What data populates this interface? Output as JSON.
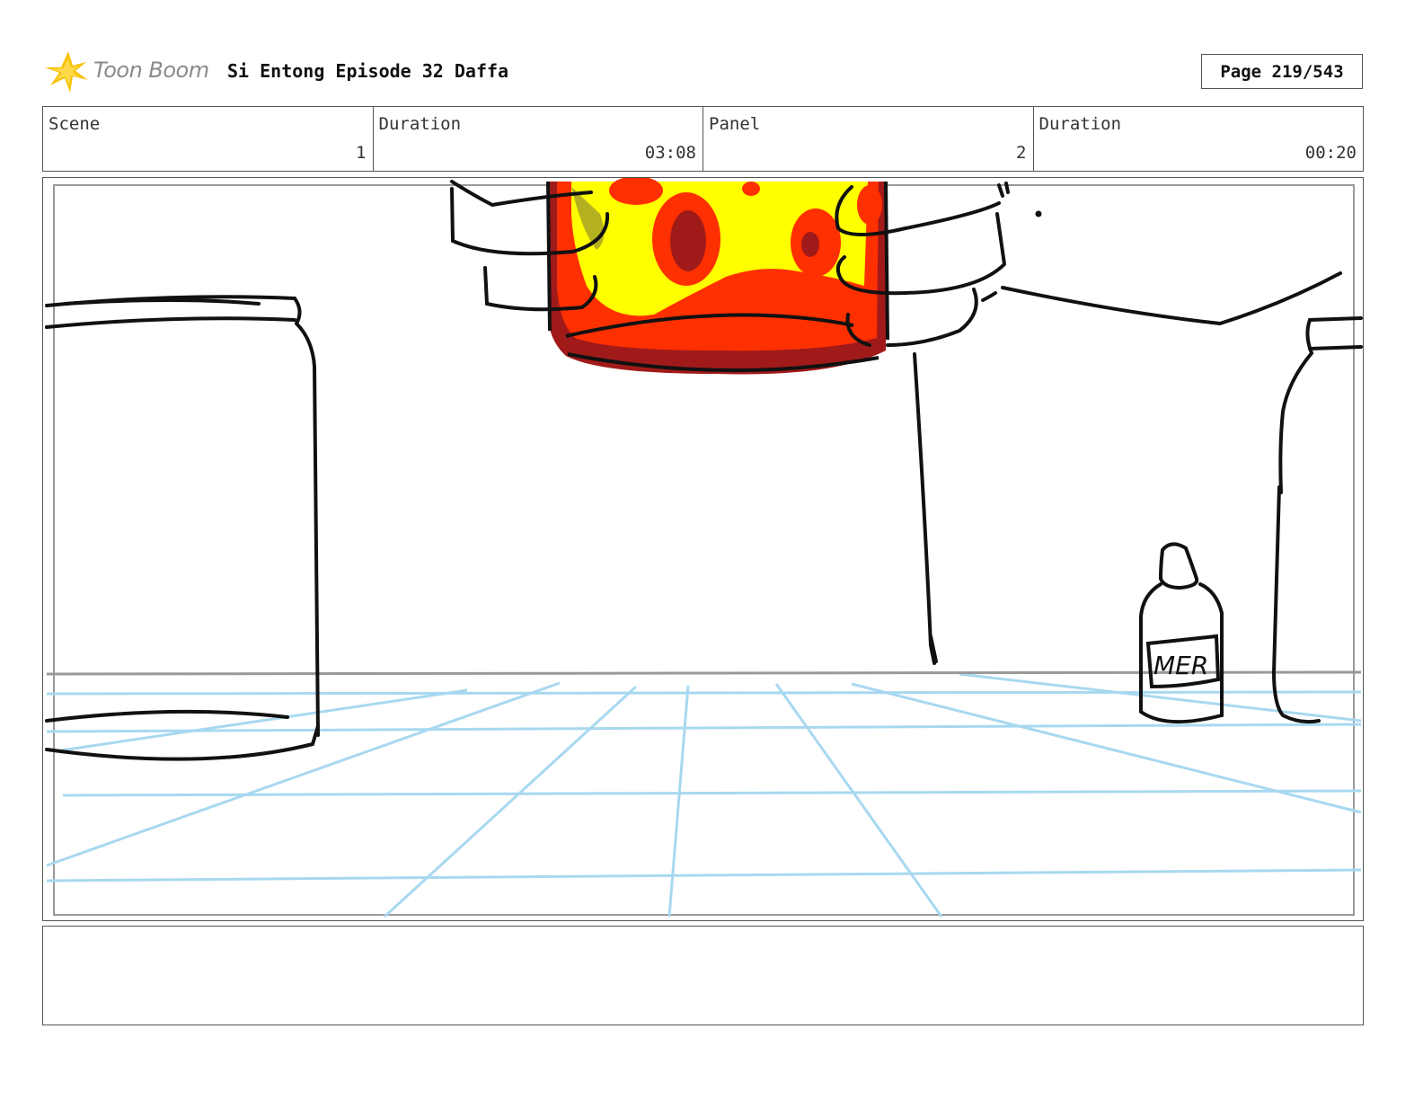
{
  "header": {
    "logo_text": "Toon Boom",
    "project_title": "Si Entong Episode 32 Daffa",
    "page_label": "Page 219/543"
  },
  "info": [
    {
      "label": "Scene",
      "value": "1"
    },
    {
      "label": "Duration",
      "value": "03:08"
    },
    {
      "label": "Panel",
      "value": "2"
    },
    {
      "label": "Duration",
      "value": "00:20"
    }
  ],
  "panel": {
    "bottle_label": "MER",
    "floor_grid_color": "#a8d8f0"
  },
  "notes": {
    "text": ""
  }
}
